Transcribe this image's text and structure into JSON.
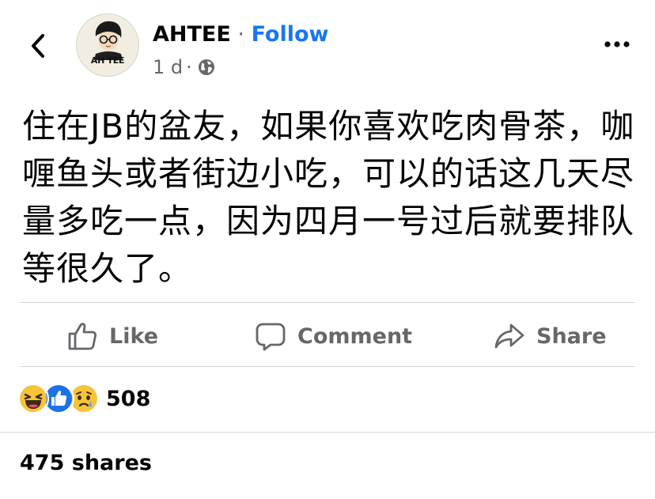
{
  "header": {
    "author_name": "AHTEE",
    "separator": " · ",
    "follow_label": "Follow",
    "timestamp": "1 d",
    "meta_separator": "·",
    "privacy_icon": "globe-icon",
    "avatar_text": "AH TEE"
  },
  "post": {
    "text": "住在JB的盆友，如果你喜欢吃肉骨茶，咖喱鱼头或者街边小吃，可以的话这几天尽量多吃一点，因为四月一号过后就要排队等很久了。"
  },
  "actions": {
    "like_label": "Like",
    "comment_label": "Comment",
    "share_label": "Share"
  },
  "engagement": {
    "reaction_icons": [
      "haha",
      "like",
      "sad"
    ],
    "reaction_count": "508",
    "shares_text": "475 shares"
  },
  "colors": {
    "accent": "#1877f2",
    "secondary_text": "#65676b",
    "divider": "#d4d6da"
  }
}
